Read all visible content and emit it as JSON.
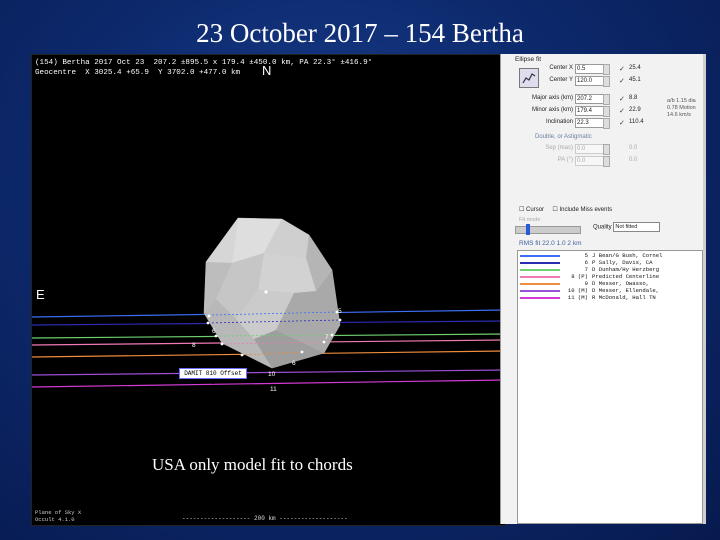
{
  "slide": {
    "title": "23 October 2017 – 154 Bertha",
    "caption": "USA only model fit to chords"
  },
  "occult": {
    "header_line1": "(154) Bertha 2017 Oct 23  207.2 ±895.5 x 179.4 ±450.0 km, PA 22.3° ±416.9°",
    "header_line2": "Geocentre  X 3025.4 +65.9  Y 3702.0 +477.0 km",
    "compass_n": "N",
    "compass_e": "E",
    "offset_label": "DAMIT 810  Offset -0°",
    "footer_line1": "Plane of Sky X",
    "footer_line2": "Occult 4.1.0",
    "scale_bar": "------------------- 200 km -------------------"
  },
  "chord_labels": [
    "8",
    "6",
    "5",
    "7",
    "6",
    "10",
    "11"
  ],
  "panel": {
    "section_title": "Ellipse fit",
    "rows": [
      {
        "label": "Center X",
        "value": "0.5",
        "check": "✓",
        "result": "25.4"
      },
      {
        "label": "Center Y",
        "value": "120.0",
        "check": "✓",
        "result": "45.1"
      },
      {
        "label": "Major axis (km)",
        "value": "207.2",
        "check": "✓",
        "result": "8.8"
      },
      {
        "label": "Minor axis (km)",
        "value": "179.4",
        "check": "✓",
        "result": "22.9"
      },
      {
        "label": "Inclination",
        "value": "22.3",
        "check": "✓",
        "result": "110.4"
      }
    ],
    "side_note": "a/b 1.15  dia 0.78  Motion 14.6 km/s",
    "double_star_head": "Double, or Astigmatic",
    "double_rows": [
      {
        "label": "Sep (mas)",
        "value": "0.0",
        "result": "0.0"
      },
      {
        "label": "PA (°)",
        "value": "0.0",
        "result": "0.0"
      }
    ],
    "options": [
      "Cursor",
      "Include Miss events"
    ],
    "slider_label": "Fit mode",
    "quality_label": "Quality",
    "quality_value": "Not fitted",
    "fit_summary": "RMS fit 22.0 1.0 2 km"
  },
  "legend": [
    {
      "num": "5",
      "who": "J Bean/G Bush, Cornel",
      "color": "#3d6ef5"
    },
    {
      "num": "6",
      "who": "P Sally, Davis, CA",
      "color": "#2c2cb2"
    },
    {
      "num": "7",
      "who": "D Dunham/Hy Herzberg",
      "color": "#6fd06f"
    },
    {
      "num": "8 (P)",
      "who": "Predicted Centerline",
      "color": "#f07ab4"
    },
    {
      "num": "9",
      "who": "D Messer, Owasso,",
      "color": "#f08c3d"
    },
    {
      "num": "10 (M)",
      "who": "D Messer, Ellendale,",
      "color": "#9b4fd6"
    },
    {
      "num": "11 (M)",
      "who": "R McDonald, Hall TN",
      "color": "#d63ad6"
    }
  ],
  "colors": {
    "slide_bg": "#0d2a6e",
    "chord_blue": "#3d6ef5",
    "chord_green": "#6fd06f",
    "chord_pink": "#f07ab4",
    "chord_orange": "#f08c3d",
    "chord_purple": "#9b4fd6",
    "chord_magenta": "#d63ad6"
  }
}
